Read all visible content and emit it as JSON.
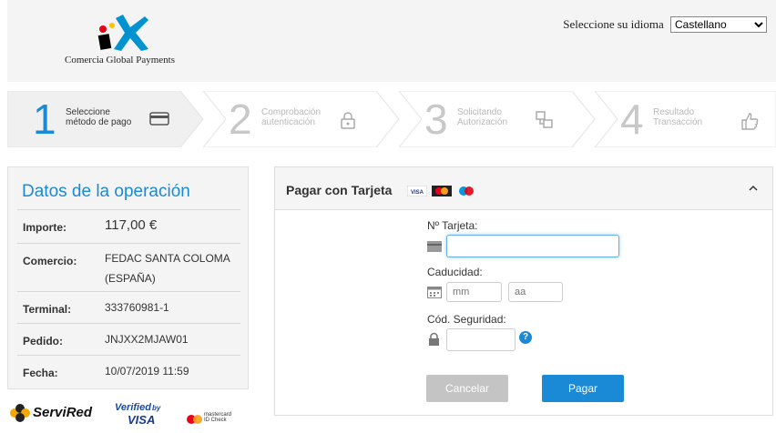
{
  "header": {
    "brand": "Comercia Global Payments",
    "language_label": "Seleccione su idioma",
    "language_selected": "Castellano"
  },
  "steps": [
    {
      "number": "1",
      "line1": "Seleccione",
      "line2": "método de pago",
      "icon": "credit-card-icon"
    },
    {
      "number": "2",
      "line1": "Comprobación",
      "line2": "autenticación",
      "icon": "lock-icon"
    },
    {
      "number": "3",
      "line1": "Solicitando",
      "line2": "Autorización",
      "icon": "transfer-icon"
    },
    {
      "number": "4",
      "line1": "Resultado",
      "line2": "Transacción",
      "icon": "thumbs-up-icon"
    }
  ],
  "operation": {
    "title": "Datos de la operación",
    "rows": [
      {
        "key": "Importe:",
        "value": "117,00 €"
      },
      {
        "key": "Comercio:",
        "value": "FEDAC SANTA COLOMA (ESPAÑA)"
      },
      {
        "key": "Terminal:",
        "value": "333760981-1"
      },
      {
        "key": "Pedido:",
        "value": "JNJXX2MJAW01"
      },
      {
        "key": "Fecha:",
        "value": "10/07/2019  11:59"
      }
    ]
  },
  "footer_logos": {
    "servired": "ServiRed",
    "verified_top": "Verified",
    "verified_by": "by",
    "verified_visa": "VISA",
    "mastercard_line1": "mastercard",
    "mastercard_line2": "ID Check"
  },
  "payment": {
    "title": "Pagar con Tarjeta",
    "card_label": "Nº Tarjeta:",
    "card_value": "",
    "expiry_label": "Caducidad:",
    "month_placeholder": "mm",
    "year_placeholder": "aa",
    "cvv_label": "Cód. Seguridad:",
    "help_glyph": "?",
    "cancel_label": "Cancelar",
    "pay_label": "Pagar",
    "visa_mini": "VISA"
  },
  "colors": {
    "accent": "#1a8ad6",
    "pay_button": "#1a8ad6",
    "cancel_button": "#c4c4c4"
  }
}
